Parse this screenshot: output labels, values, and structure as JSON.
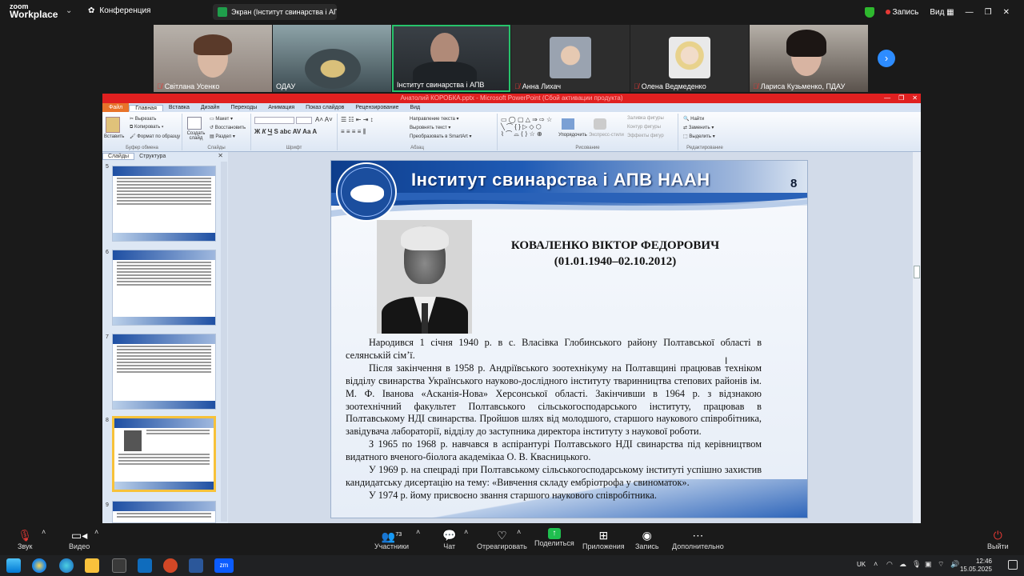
{
  "zoom": {
    "logo_top": "zoom",
    "logo_bottom": "Workplace",
    "meeting_label": "Конференция",
    "screen_share_label": "Экран (Інститут свинарства і АГ",
    "record_label": "Запись",
    "view_label": "Вид"
  },
  "participants": [
    {
      "name": "Світлана Усенко",
      "muted": true
    },
    {
      "name": "ОДАУ",
      "muted": false
    },
    {
      "name": "Інститут свинарства і АПВ",
      "muted": false
    },
    {
      "name": "Анна Лихач",
      "muted": true
    },
    {
      "name": "Олена Ведмеденко",
      "muted": true
    },
    {
      "name": "Лариса Кузьменко, ПДАУ",
      "muted": true
    }
  ],
  "ppt": {
    "title": "Анатолий КОРОБКА.pptx - Microsoft PowerPoint (Сбой активации продукта)",
    "tabs": [
      "Файл",
      "Главная",
      "Вставка",
      "Дизайн",
      "Переходы",
      "Анимация",
      "Показ слайдов",
      "Рецензирование",
      "Вид"
    ],
    "groups": {
      "clipboard": {
        "paste": "Вставить",
        "cut": "Вырезать",
        "copy": "Копировать",
        "format": "Формат по образцу",
        "label": "Буфер обмена"
      },
      "slides": {
        "new": "Создать слайд",
        "layout": "Макет",
        "reset": "Восстановить",
        "section": "Раздел",
        "label": "Слайды"
      },
      "font": {
        "label": "Шрифт"
      },
      "paragraph": {
        "dir": "Направление текста",
        "align": "Выровнять текст",
        "smartart": "Преобразовать в SmartArt",
        "label": "Абзац"
      },
      "drawing": {
        "arrange": "Упорядочить",
        "styles": "Экспресс-стили",
        "fill": "Заливка фигуры",
        "outline": "Контур фигуры",
        "effects": "Эффекты фигур",
        "label": "Рисование"
      },
      "editing": {
        "find": "Найти",
        "replace": "Заменить",
        "select": "Выделить",
        "label": "Редактирование"
      }
    },
    "pane_tabs": [
      "Слайды",
      "Структура"
    ],
    "slide_numbers": [
      "5",
      "6",
      "7",
      "8",
      "9"
    ],
    "selected_slide": "8"
  },
  "slide": {
    "header": "Інститут свинарства і АПВ НААН",
    "number": "8",
    "name_line1": "КОВАЛЕНКО ВІКТОР ФЕДОРОВИЧ",
    "name_line2": "(01.01.1940–02.10.2012)",
    "paragraphs": [
      "Народився 1 січня 1940 р. в с. Власівка Глобинського району Полтавської області в селянській сім’ї.",
      "Після закінчення в 1958 р. Андріївського зоотехнікуму на Полтавщині працював техніком відділу свинарства Українського науково-дослідного інституту тваринництва степових районів ім. М. Ф. Іванова «Асканія-Нова» Херсонської області. Закінчивши в 1964 р. з відзнакою зоотехнічний факультет Полтавського сільськогосподарського інституту, працював в Полтавському НДІ свинарства. Пройшов шлях від молодшого, старшого наукового співробітника, завідувача лабораторії, відділу до заступника директора інституту з наукової роботи.",
      "З 1965 по 1968 р. навчався в аспірантурі Полтавського НДІ свинарства під керівництвом видатного вченого-біолога академікаа О. В. Квасницького.",
      "У 1969 р. на спецраді при Полтавському сільськогосподарському інституті успішно захистив кандидатську дисертацію на тему: «Вивчення складу ембріотрофа у свиноматок».",
      "У 1974 р. йому присвоєно звання старшого наукового співробітника."
    ]
  },
  "toolbar": {
    "audio": "Звук",
    "video": "Видео",
    "participants": "Участники",
    "participants_count": "73",
    "chat": "Чат",
    "react": "Отреагировать",
    "share": "Поделиться",
    "apps": "Приложения",
    "record": "Запись",
    "more": "Дополнительно",
    "leave": "Выйти"
  },
  "taskbar": {
    "lang": "UK",
    "time": "12:46",
    "date": "15.05.2025"
  },
  "colors": {
    "zoom_bg": "#1a1a1a",
    "share_green": "#1fbf4f",
    "ppt_title_red": "#e02020",
    "slide_blue": "#1f5bb5"
  }
}
